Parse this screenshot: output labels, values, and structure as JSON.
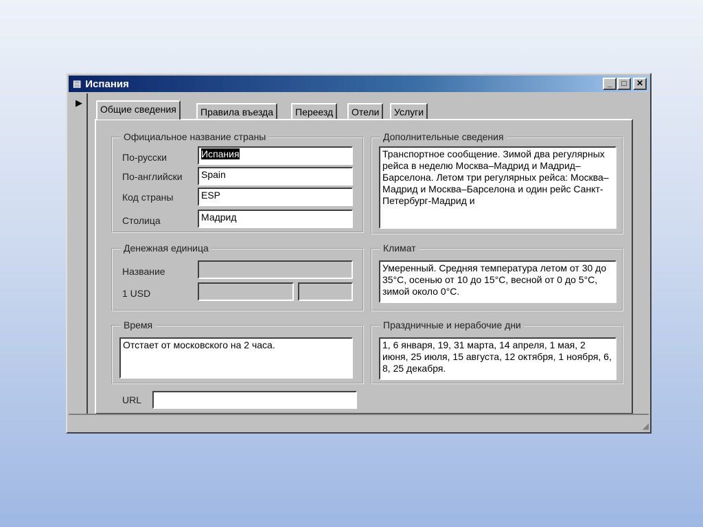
{
  "window": {
    "title": "Испания",
    "minimize": "_",
    "maximize": "□",
    "close": "✕"
  },
  "tabs": [
    "Общие сведения",
    "Правила въезда",
    "Переезд",
    "Отели",
    "Услуги"
  ],
  "official_name": {
    "legend": "Официальное название страны",
    "fields": [
      {
        "label": "По-русски",
        "value": "Испания"
      },
      {
        "label": "По-английски",
        "value": "Spain"
      },
      {
        "label": "Код страны",
        "value": "ESP"
      },
      {
        "label": "Столица",
        "value": "Мадрид"
      }
    ]
  },
  "currency": {
    "legend": "Денежная единица",
    "name_label": "Название",
    "name_value": "",
    "usd_label": "1 USD",
    "usd_value1": "",
    "usd_value2": ""
  },
  "time": {
    "legend": "Время",
    "value": "Отстает от московского на 2 часа."
  },
  "url": {
    "label": "URL",
    "value": ""
  },
  "additional": {
    "legend": "Дополнительные сведения",
    "value": "Транспортное сообщение. Зимой два регулярных рейса в неделю Москва–Мадрид и Мадрид–Барселона. Летом три регулярных рейса: Москва–Мадрид и Москва–Барселона и один рейс Санкт-Петербург-Мадрид и"
  },
  "climate": {
    "legend": "Климат",
    "value": "Умеренный. Средняя температура летом от 30 до 35°C, осенью от 10 до 15°C, весной от 0 до 5°C, зимой около 0°C."
  },
  "holidays": {
    "legend": "Праздничные и нерабочие дни",
    "value": "1, 6 января, 19, 31 марта, 14 апреля, 1 мая, 2 июня, 25 июля, 15 августа, 12 октября, 1 ноября, 6, 8, 25 декабря."
  }
}
